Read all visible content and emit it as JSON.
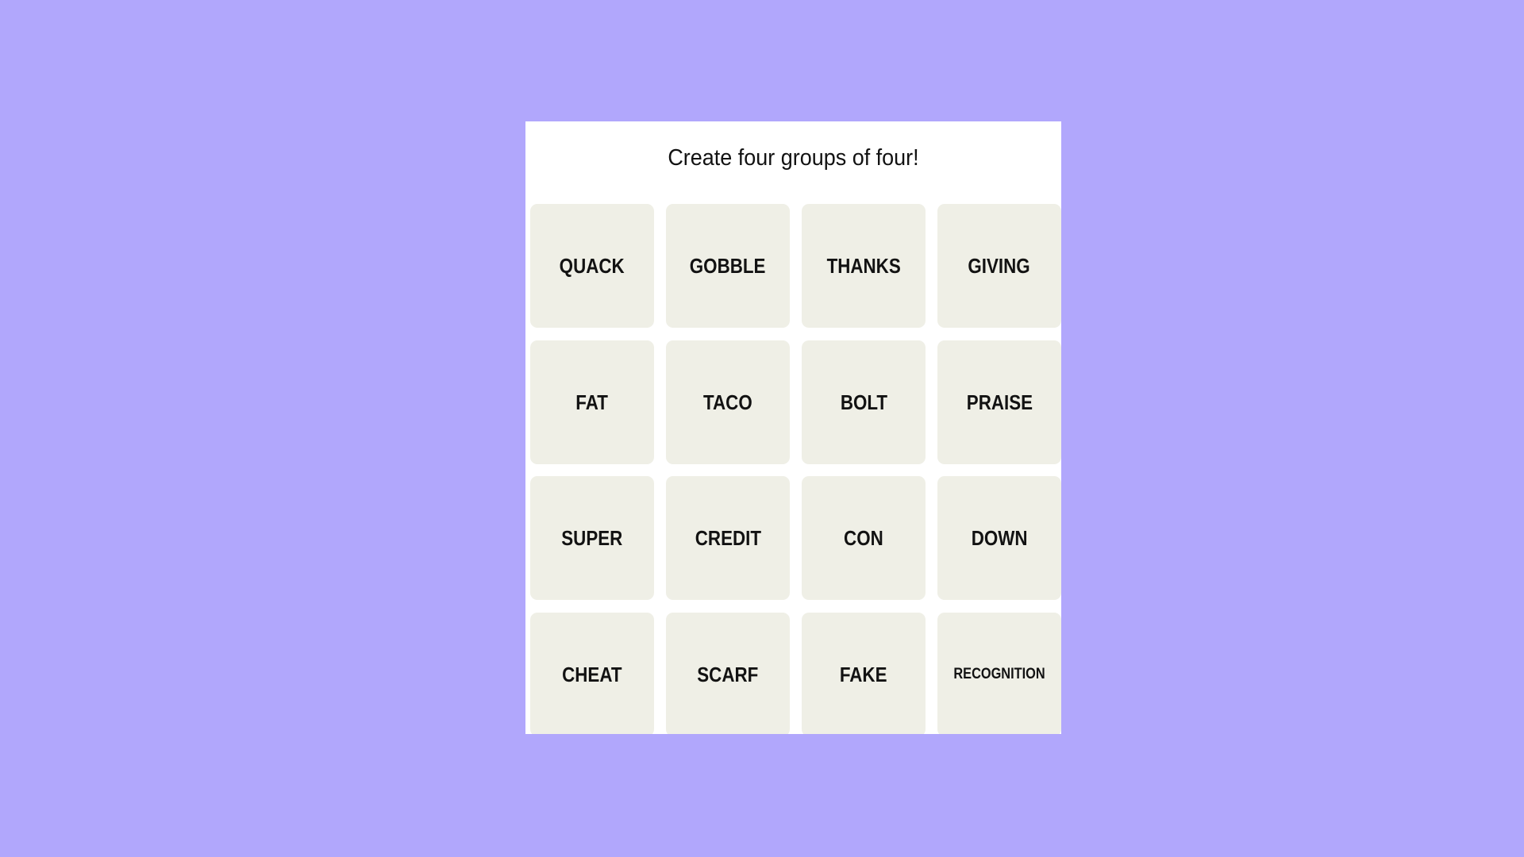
{
  "game": {
    "title": "Create four groups of four!",
    "colors": {
      "background": "#b1a7fc",
      "panel": "#ffffff",
      "tile": "#efefe6",
      "text": "#121212"
    },
    "tiles": [
      {
        "label": "QUACK"
      },
      {
        "label": "GOBBLE"
      },
      {
        "label": "THANKS"
      },
      {
        "label": "GIVING"
      },
      {
        "label": "FAT"
      },
      {
        "label": "TACO"
      },
      {
        "label": "BOLT"
      },
      {
        "label": "PRAISE"
      },
      {
        "label": "SUPER"
      },
      {
        "label": "CREDIT"
      },
      {
        "label": "CON"
      },
      {
        "label": "DOWN"
      },
      {
        "label": "CHEAT"
      },
      {
        "label": "SCARF"
      },
      {
        "label": "FAKE"
      },
      {
        "label": "RECOGNITION"
      }
    ]
  }
}
